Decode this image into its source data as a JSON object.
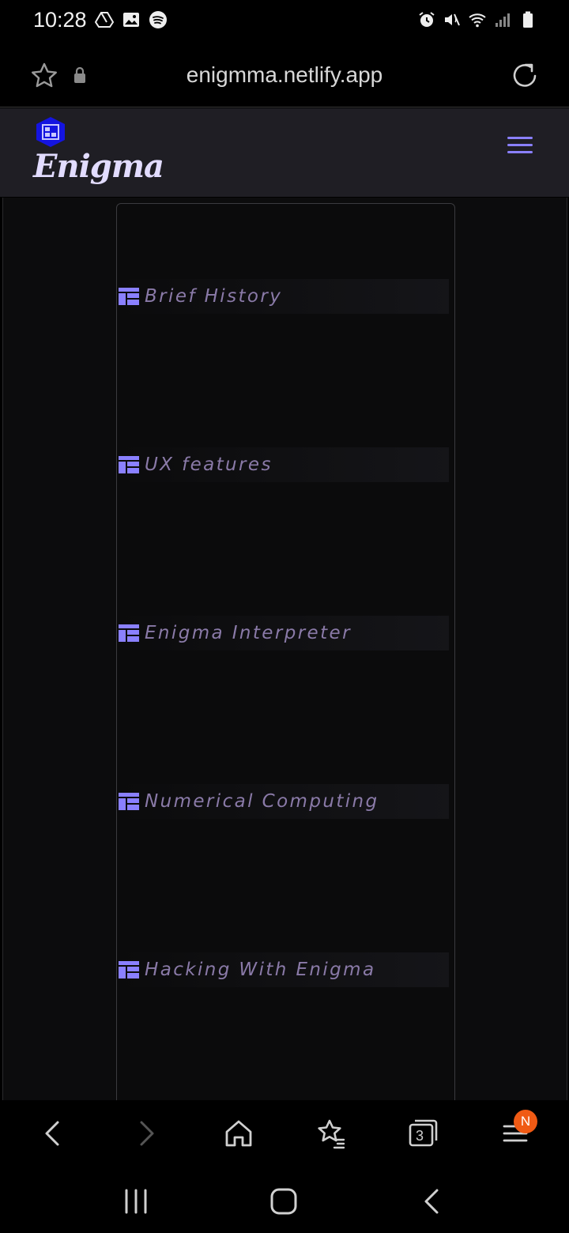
{
  "status_bar": {
    "time": "10:28",
    "left_icons": [
      "drive-icon",
      "image-icon",
      "spotify-icon"
    ],
    "right_icons": [
      "alarm-icon",
      "mute-icon",
      "wifi-icon",
      "signal-icon",
      "battery-icon"
    ]
  },
  "browser": {
    "url": "enigmma.netlify.app",
    "tabs_count": "3",
    "notification_badge": "N"
  },
  "site": {
    "brand": "Enigma",
    "accent_color": "#8a80ff",
    "logo_color": "#1414e0"
  },
  "toc": {
    "items": [
      {
        "label": "Brief History"
      },
      {
        "label": "UX features"
      },
      {
        "label": "Enigma Interpreter"
      },
      {
        "label": "Numerical Computing"
      },
      {
        "label": "Hacking With Enigma"
      }
    ]
  }
}
